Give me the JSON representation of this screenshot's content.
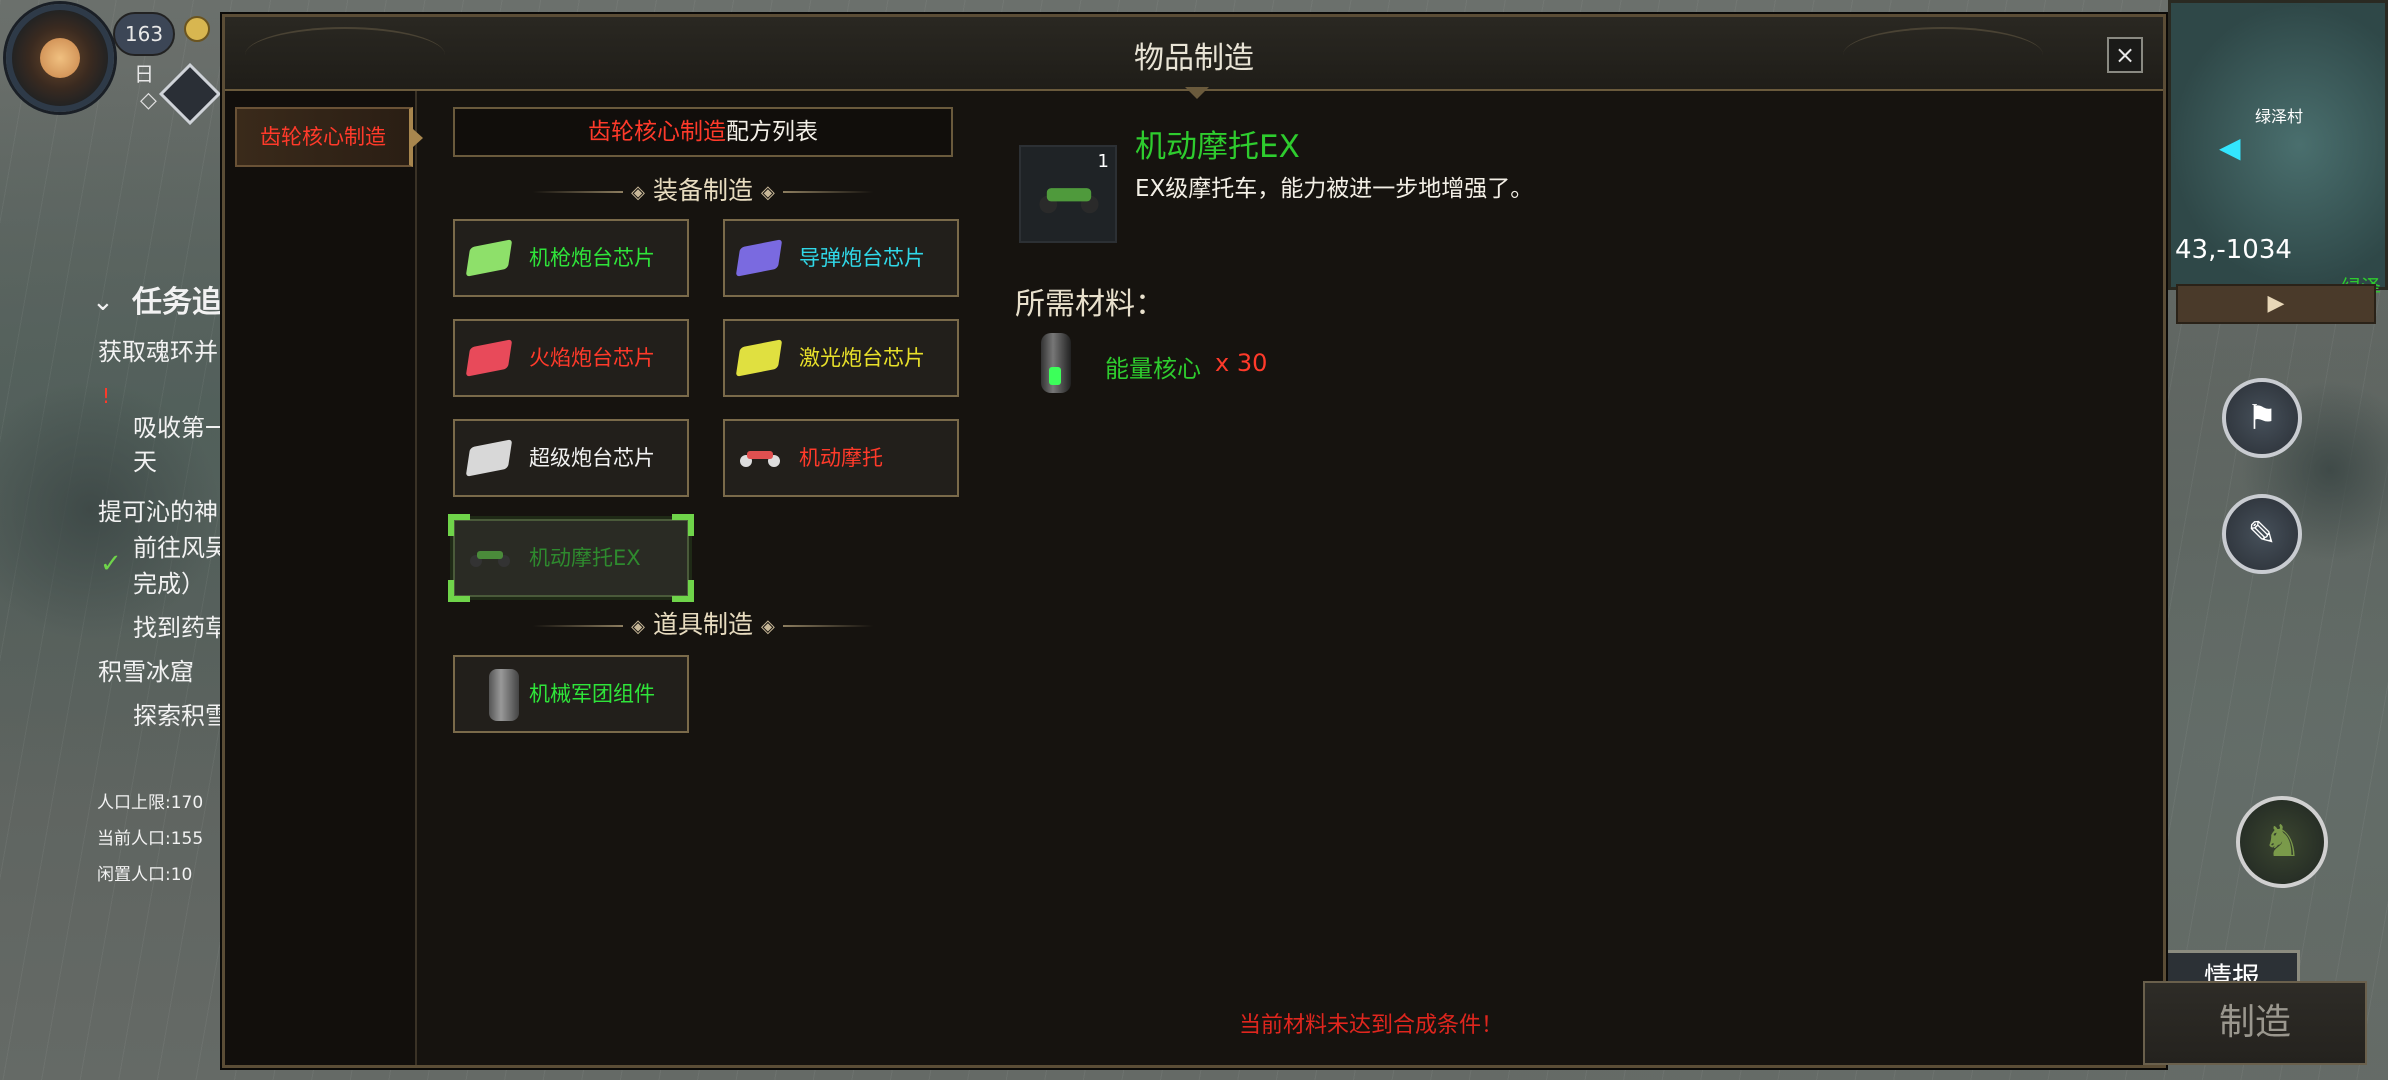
{
  "hud": {
    "day": "163日",
    "quest_title": "任务追",
    "quests": [
      {
        "text": "获取魂环并",
        "indent": false
      },
      {
        "text": "吸收第一",
        "indent": true
      },
      {
        "text": "天",
        "indent": true
      },
      {
        "text": "提可沁的神",
        "indent": false
      },
      {
        "text": "前往风吴",
        "indent": true
      },
      {
        "text": "完成）",
        "indent": true
      },
      {
        "text": "找到药草",
        "indent": true
      },
      {
        "text": "积雪冰窟",
        "indent": false
      },
      {
        "text": "探索积雪",
        "indent": true
      }
    ],
    "population": {
      "limit": "人口上限:170",
      "current": "当前人口:155",
      "idle": "闲置人口:10"
    },
    "minimap": {
      "village": "绿泽村",
      "coords": "43,-1034",
      "edge_label": "绿泽"
    },
    "intel_button": "情报"
  },
  "dialog": {
    "title": "物品制造",
    "close_label": "×",
    "category_tab": "齿轮核心制造",
    "recipe_header": {
      "highlight": "齿轮核心制造",
      "rest": "配方列表"
    },
    "sections": {
      "equipment": "装备制造",
      "items": "道具制造"
    },
    "recipes": [
      {
        "label": "机枪炮台芯片",
        "color": "#2fe43a",
        "chip": "#8ee06a"
      },
      {
        "label": "导弹炮台芯片",
        "color": "#30d8e8",
        "chip": "#7a6ae0"
      },
      {
        "label": "火焰炮台芯片",
        "color": "#ff3a2a",
        "chip": "#e84a5a"
      },
      {
        "label": "激光炮台芯片",
        "color": "#e8e02a",
        "chip": "#e0e040"
      },
      {
        "label": "超级炮台芯片",
        "color": "#f2f2f2",
        "chip": "#d8d8d8"
      },
      {
        "label": "机动摩托",
        "color": "#ff3a2a",
        "chip": "#e05050"
      },
      {
        "label": "机动摩托EX",
        "color": "#2e8a2e",
        "chip": "#4a8a3a"
      }
    ],
    "item_recipes": [
      {
        "label": "机械军团组件",
        "color": "#2fe43a"
      }
    ],
    "detail": {
      "quantity": "1",
      "name": "机动摩托EX",
      "description": "EX级摩托车，能力被进一步地增强了。",
      "materials_title": "所需材料：",
      "material_name": "能量核心",
      "material_count": "x 30"
    },
    "warning": "当前材料未达到合成条件！",
    "craft_button": "制造"
  }
}
